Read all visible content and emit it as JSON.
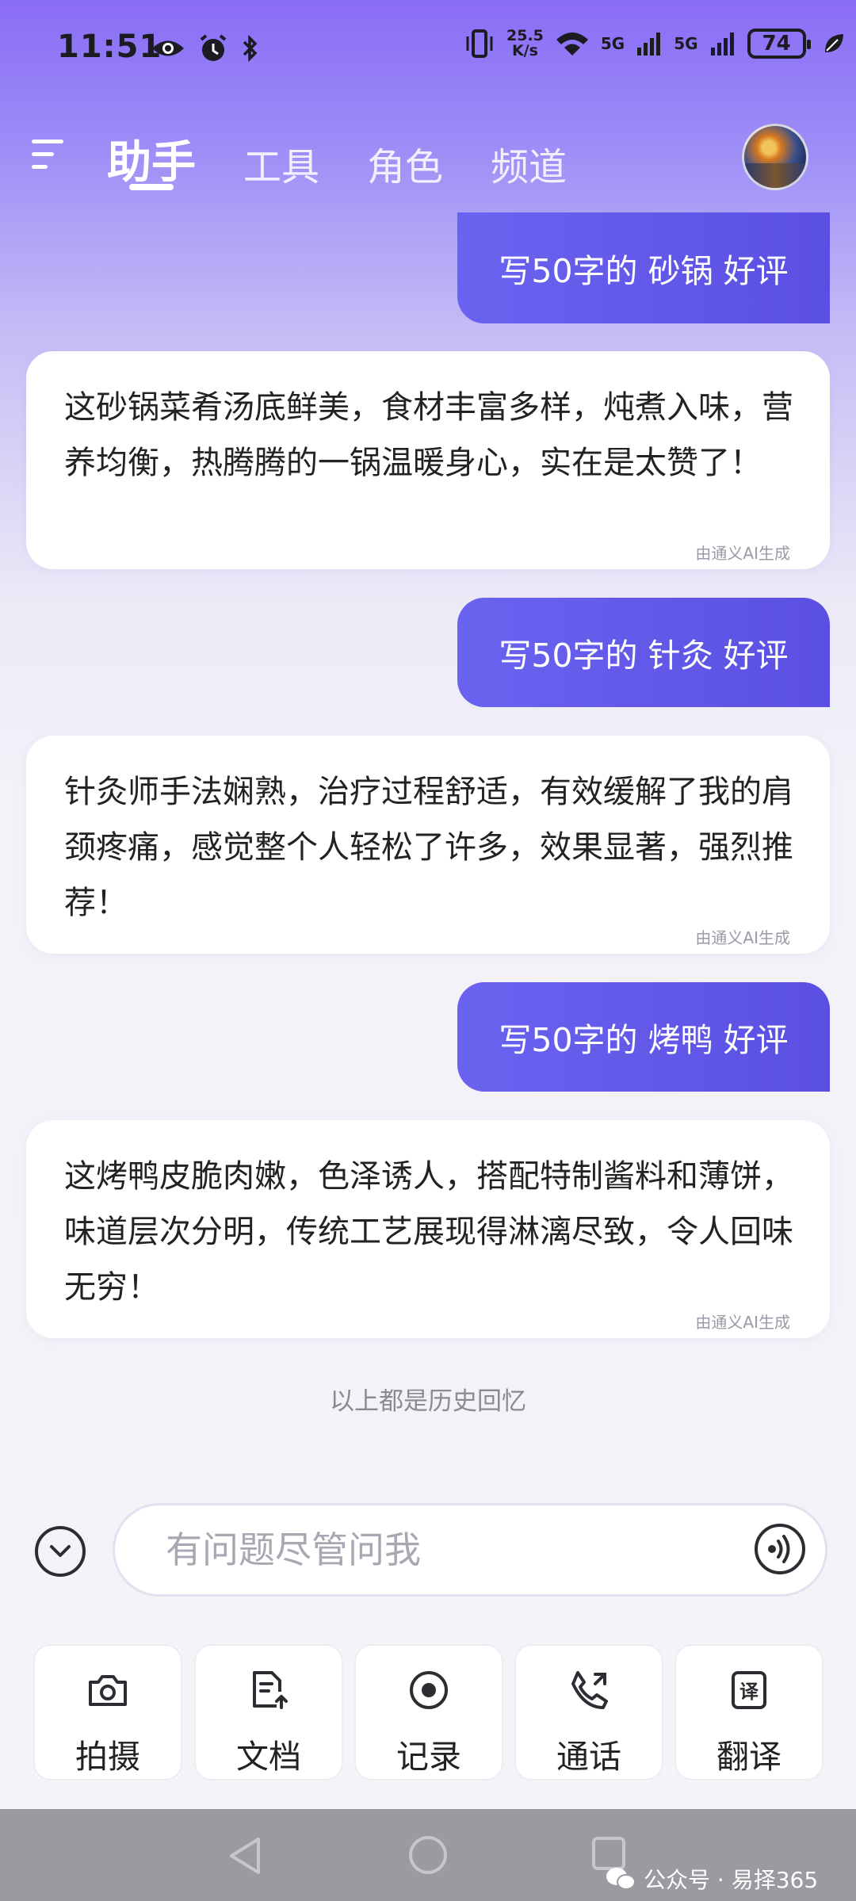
{
  "status_bar": {
    "time": "11:51",
    "speed_value": "25.5",
    "speed_unit": "K/s",
    "net1": "5G",
    "net2": "5G",
    "battery": "74"
  },
  "header": {
    "tabs": [
      {
        "label": "助手"
      },
      {
        "label": "工具"
      },
      {
        "label": "角色"
      },
      {
        "label": "频道"
      }
    ]
  },
  "chat": {
    "messages": [
      {
        "role": "user",
        "text": "写50字的 砂锅 好评"
      },
      {
        "role": "ai",
        "text": "这砂锅菜肴汤底鲜美，食材丰富多样，炖煮入味，营养均衡，热腾腾的一锅温暖身心，实在是太赞了！",
        "tag": "由通义AI生成"
      },
      {
        "role": "user",
        "text": "写50字的 针灸 好评"
      },
      {
        "role": "ai",
        "text": "针灸师手法娴熟，治疗过程舒适，有效缓解了我的肩颈疼痛，感觉整个人轻松了许多，效果显著，强烈推荐！",
        "tag": "由通义AI生成"
      },
      {
        "role": "user",
        "text": "写50字的 烤鸭 好评"
      },
      {
        "role": "ai",
        "text": "这烤鸭皮脆肉嫩，色泽诱人，搭配特制酱料和薄饼，味道层次分明，传统工艺展现得淋漓尽致，令人回味无穷！",
        "tag": "由通义AI生成"
      }
    ],
    "history_note": "以上都是历史回忆"
  },
  "input": {
    "placeholder": "有问题尽管问我",
    "value": ""
  },
  "tools": [
    {
      "label": "拍摄",
      "icon": "camera-icon"
    },
    {
      "label": "文档",
      "icon": "document-upload-icon"
    },
    {
      "label": "记录",
      "icon": "record-icon"
    },
    {
      "label": "通话",
      "icon": "phone-call-icon"
    },
    {
      "label": "翻译",
      "icon": "translate-icon"
    }
  ],
  "watermark": "公众号 · 易择365",
  "colors": {
    "accent": "#5f57e8",
    "header_gradient_top": "#8a6cf5",
    "background": "#f3f3f8"
  }
}
